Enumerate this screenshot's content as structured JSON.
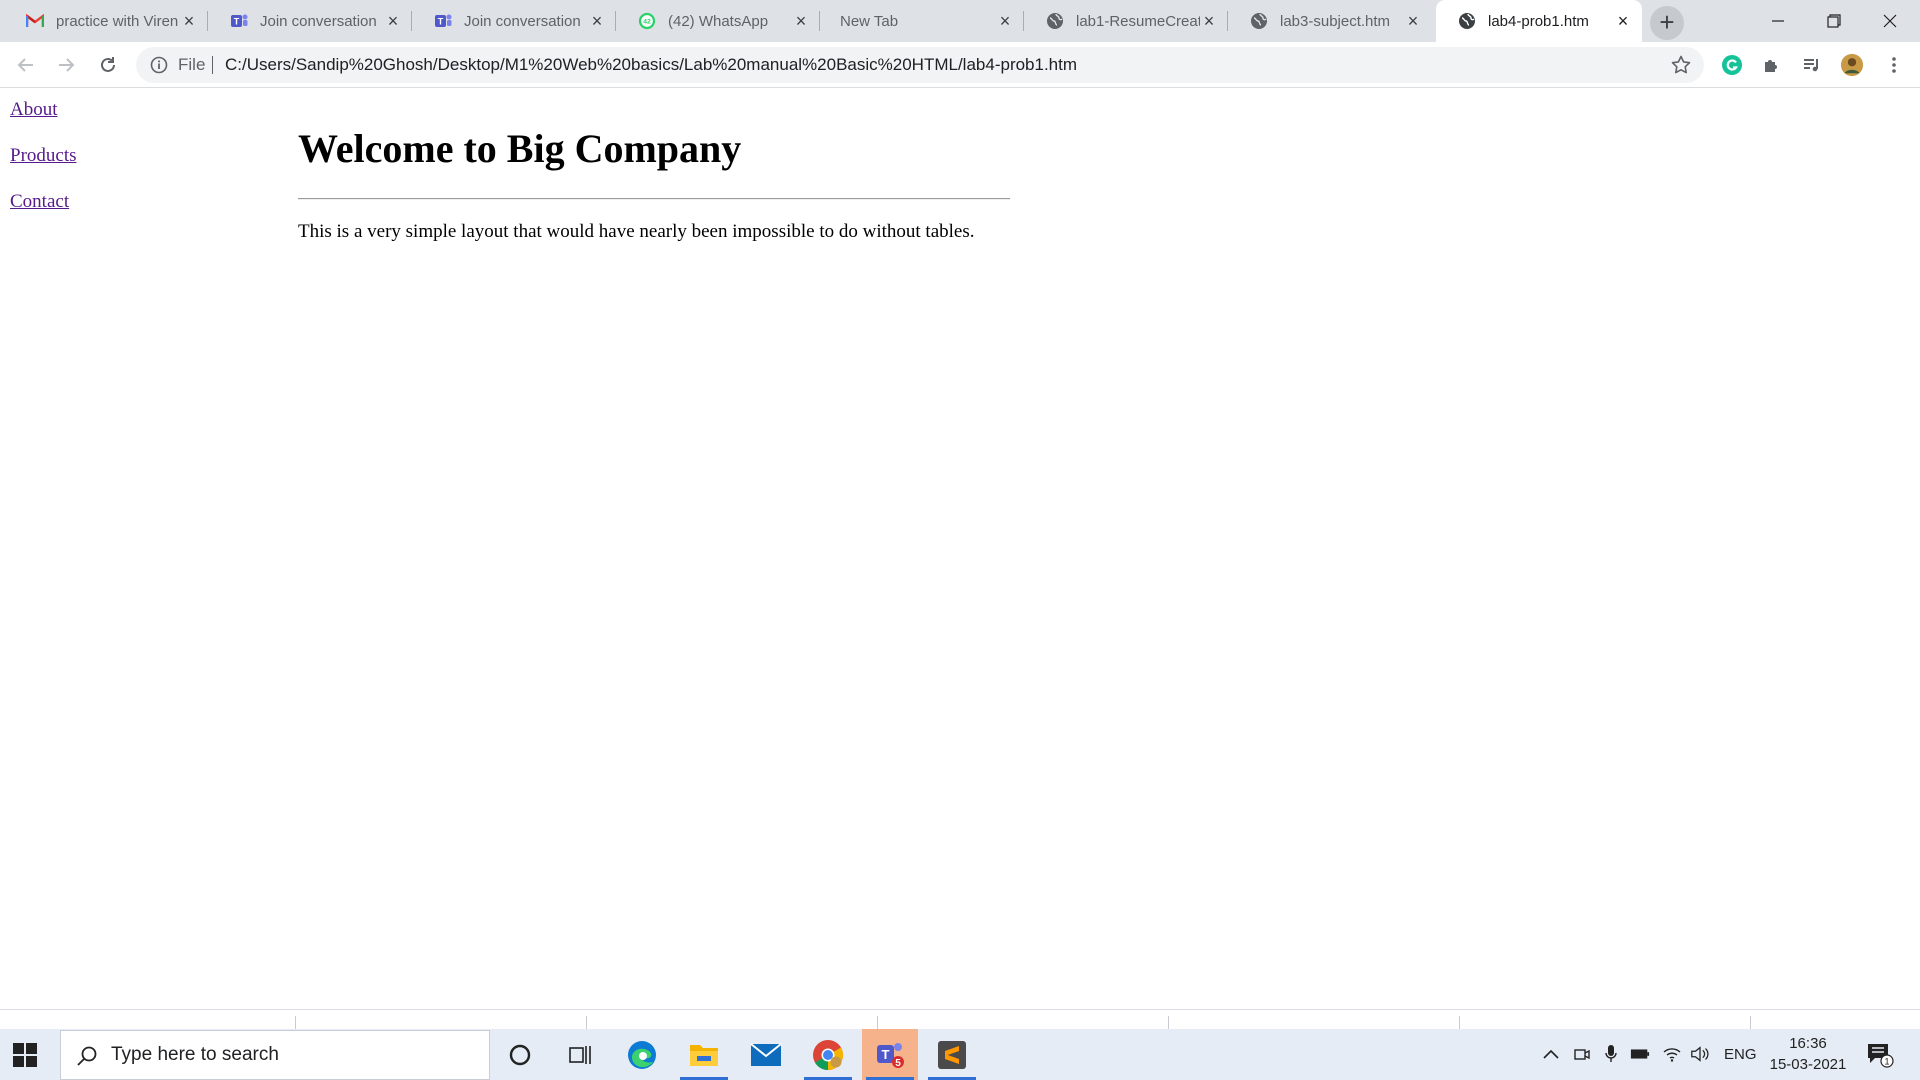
{
  "browser": {
    "tabs": [
      {
        "title": "practice with Viren",
        "icon": "gmail-icon",
        "active": false
      },
      {
        "title": "Join conversation",
        "icon": "teams-icon",
        "active": false
      },
      {
        "title": "Join conversation",
        "icon": "teams-icon",
        "active": false
      },
      {
        "title": "(42) WhatsApp",
        "icon": "whatsapp-icon",
        "badge": "42",
        "active": false
      },
      {
        "title": "New Tab",
        "icon": "",
        "active": false
      },
      {
        "title": "lab1-ResumeCreat",
        "icon": "globe-icon",
        "active": false
      },
      {
        "title": "lab3-subject.htm",
        "icon": "globe-icon",
        "active": false
      },
      {
        "title": "lab4-prob1.htm",
        "icon": "globe-icon",
        "active": true
      }
    ],
    "address": {
      "scheme_label": "File",
      "url": "C:/Users/Sandip%20Ghosh/Desktop/M1%20Web%20basics/Lab%20manual%20Basic%20HTML/lab4-prob1.htm"
    }
  },
  "page": {
    "nav": [
      "About",
      "Products",
      "Contact"
    ],
    "heading": "Welcome to Big Company",
    "paragraph": "This is a very simple layout that would have nearly been impossible to do without tables."
  },
  "taskbar": {
    "search_placeholder": "Type here to search",
    "language": "ENG",
    "time": "16:36",
    "date": "15-03-2021",
    "teams_badge": "5",
    "notification_count": "1"
  },
  "colors": {
    "tab_strip": "#dee1e6",
    "link_visited": "#551a8b",
    "taskbar": "#e5ecf5",
    "whatsapp": "#25d366",
    "grammarly": "#15c39a"
  }
}
